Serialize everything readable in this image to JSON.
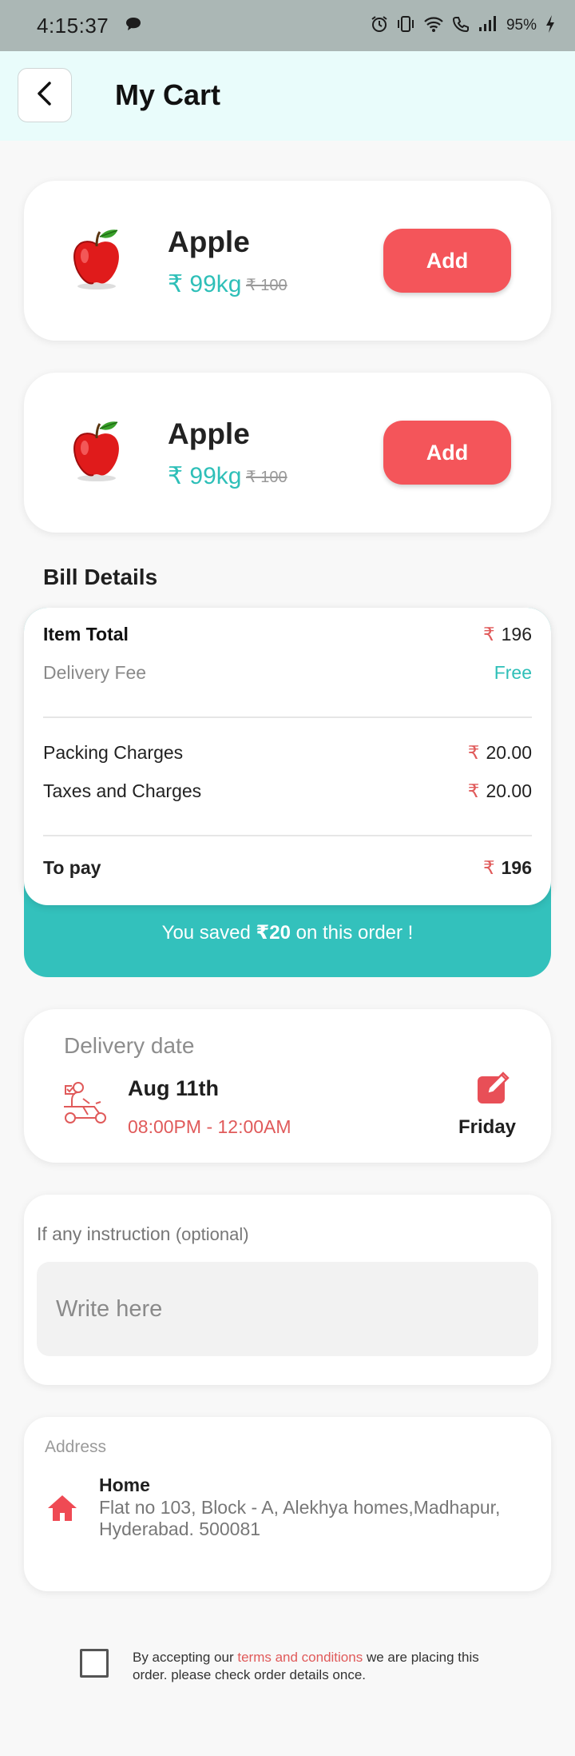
{
  "status_bar": {
    "time": "4:15:37",
    "battery": "95%"
  },
  "header": {
    "title": "My Cart"
  },
  "cart": {
    "items": [
      {
        "name": "Apple",
        "price": "₹ 99kg",
        "mrp": "₹ 100",
        "add_label": "Add",
        "icon": "apple-icon"
      },
      {
        "name": "Apple",
        "price": "₹ 99kg",
        "mrp": "₹ 100",
        "add_label": "Add",
        "icon": "apple-icon"
      }
    ]
  },
  "bill": {
    "title": "Bill Details",
    "item_total_label": "Item Total",
    "item_total_value": "196",
    "delivery_fee_label": "Delivery Fee",
    "delivery_fee_value": "Free",
    "packing_label": "Packing Charges",
    "packing_value": "20.00",
    "taxes_label": "Taxes and Charges",
    "taxes_value": "20.00",
    "to_pay_label": "To pay",
    "to_pay_value": "196",
    "rupee": "₹",
    "saved_prefix": "You saved ",
    "saved_amount": "₹20",
    "saved_suffix": " on this order !"
  },
  "delivery": {
    "label": "Delivery date",
    "date": "Aug 11th",
    "time": "08:00PM - 12:00AM",
    "day": "Friday"
  },
  "instruction": {
    "label": "If any instruction",
    "optional": "(optional)",
    "placeholder": "Write here"
  },
  "address": {
    "label": "Address",
    "name": "Home",
    "line": "Flat no 103, Block - A, Alekhya homes,Madhapur, Hyderabad. 500081"
  },
  "terms": {
    "prefix": "By accepting our ",
    "link": "terms and conditions",
    "suffix": " we are placing this order. please check order details once."
  },
  "colors": {
    "accent": "#f4555a",
    "teal": "#33c1bc",
    "header_bg": "#e9fcfb",
    "status_bar_bg": "#abb7b5"
  }
}
